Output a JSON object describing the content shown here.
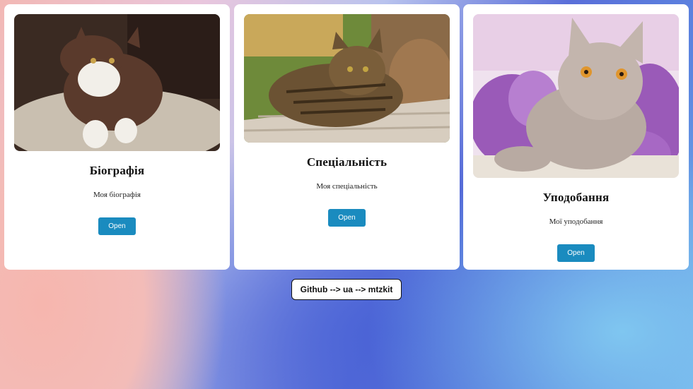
{
  "cards": [
    {
      "title": "Біографія",
      "description": "Моя біографія",
      "button_label": "Open",
      "image": "brown-white-cat-photo"
    },
    {
      "title": "Спеціальність",
      "description": "Моя спеціальність",
      "button_label": "Open",
      "image": "tabby-cat-photo"
    },
    {
      "title": "Уподобання",
      "description": "Мої уподобання",
      "button_label": "Open",
      "image": "gray-cat-lilac-photo"
    }
  ],
  "footer": {
    "github_label": "Github --> ua --> mtzkit"
  },
  "colors": {
    "button": "#1a8bbf",
    "card": "#ffffff"
  }
}
